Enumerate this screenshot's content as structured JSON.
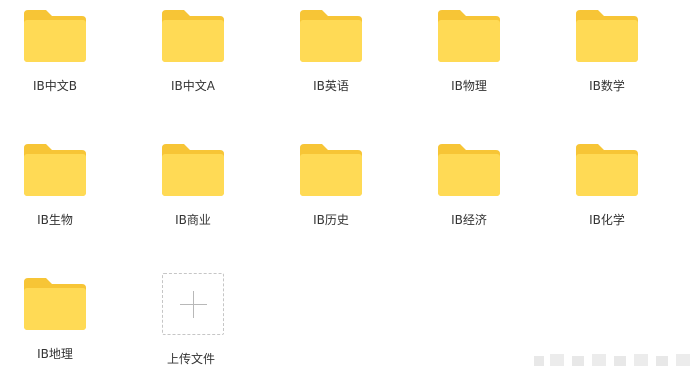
{
  "colors": {
    "folder_back": "#f7c536",
    "folder_front": "#ffda55",
    "upload_border": "#c6c6c6",
    "upload_plus": "#b8b8b8",
    "label_text": "#333333"
  },
  "folders": [
    {
      "label": "IB中文B",
      "icon": "folder-icon"
    },
    {
      "label": "IB中文A",
      "icon": "folder-icon"
    },
    {
      "label": "IB英语",
      "icon": "folder-icon"
    },
    {
      "label": "IB物理",
      "icon": "folder-icon"
    },
    {
      "label": "IB数学",
      "icon": "folder-icon"
    },
    {
      "label": "IB生物",
      "icon": "folder-icon"
    },
    {
      "label": "IB商业",
      "icon": "folder-icon"
    },
    {
      "label": "IB历史",
      "icon": "folder-icon"
    },
    {
      "label": "IB经济",
      "icon": "folder-icon"
    },
    {
      "label": "IB化学",
      "icon": "folder-icon"
    },
    {
      "label": "IB地理",
      "icon": "folder-icon"
    }
  ],
  "upload": {
    "label": "上传文件",
    "icon": "plus-icon"
  }
}
